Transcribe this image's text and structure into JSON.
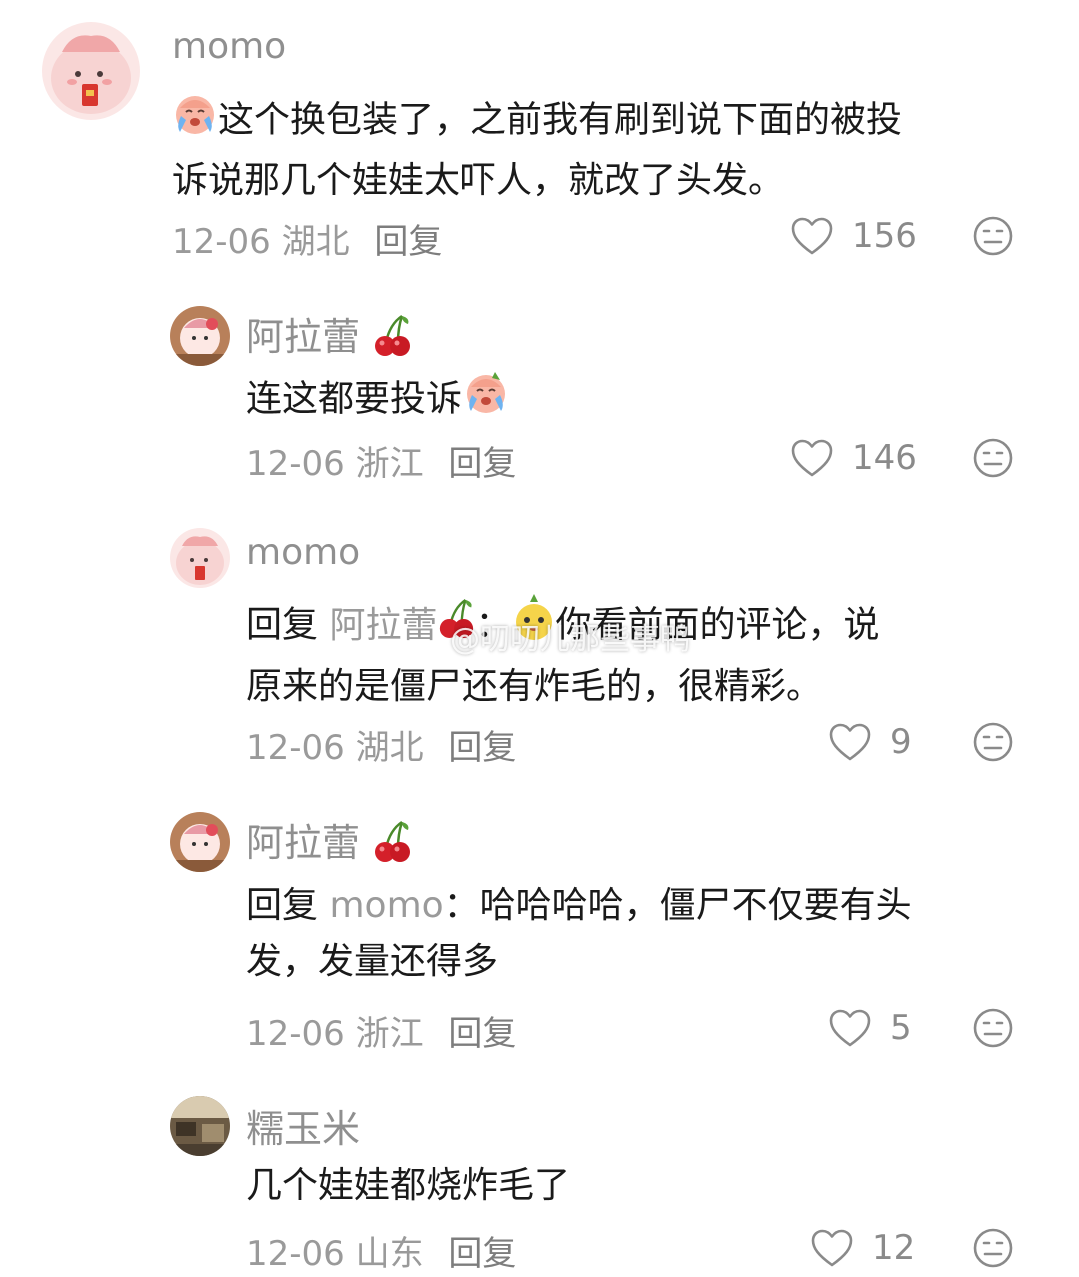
{
  "comments": [
    {
      "username": "momo",
      "text": "这个换包装了，之前我有刷到说下面的被投诉说那几个娃娃太吓人，就改了头发。",
      "text_line1": "这个换包装了，之前我有刷到说下面的被投",
      "text_line2": "诉说那几个娃娃太吓人，就改了头发。",
      "date": "12-06",
      "location": "湖北",
      "reply_label": "回复",
      "likes": "156"
    },
    {
      "username": "阿拉蕾",
      "text": "连这都要投诉",
      "date": "12-06",
      "location": "浙江",
      "reply_label": "回复",
      "likes": "146"
    },
    {
      "username": "momo",
      "reply_prefix": "回复",
      "reply_to": "阿拉蕾",
      "colon": "：",
      "text_line1": "你看前面的评论，说",
      "text_line2": "原来的是僵尸还有炸毛的，很精彩。",
      "date": "12-06",
      "location": "湖北",
      "reply_label": "回复",
      "likes": "9"
    },
    {
      "username": "阿拉蕾",
      "reply_prefix": "回复",
      "reply_to": "momo",
      "colon": "：",
      "text_line1": "哈哈哈哈，僵尸不仅要有头",
      "text_line2": "发，发量还得多",
      "date": "12-06",
      "location": "浙江",
      "reply_label": "回复",
      "likes": "5"
    },
    {
      "username": "糯玉米",
      "text": "几个娃娃都烧炸毛了",
      "date": "12-06",
      "location": "山东",
      "reply_label": "回复",
      "likes": "12"
    }
  ],
  "watermark": "@叨叨儿那些事鸭",
  "icons": {
    "like": "heart-outline-icon",
    "dislike": "meh-face-icon",
    "cherry": "cherry-icon",
    "crying": "crying-face-icon"
  },
  "colors": {
    "text": "#1a1a1a",
    "muted": "#9a9a9a",
    "icon": "#8a8a8a",
    "cherry": "#d4202a"
  }
}
